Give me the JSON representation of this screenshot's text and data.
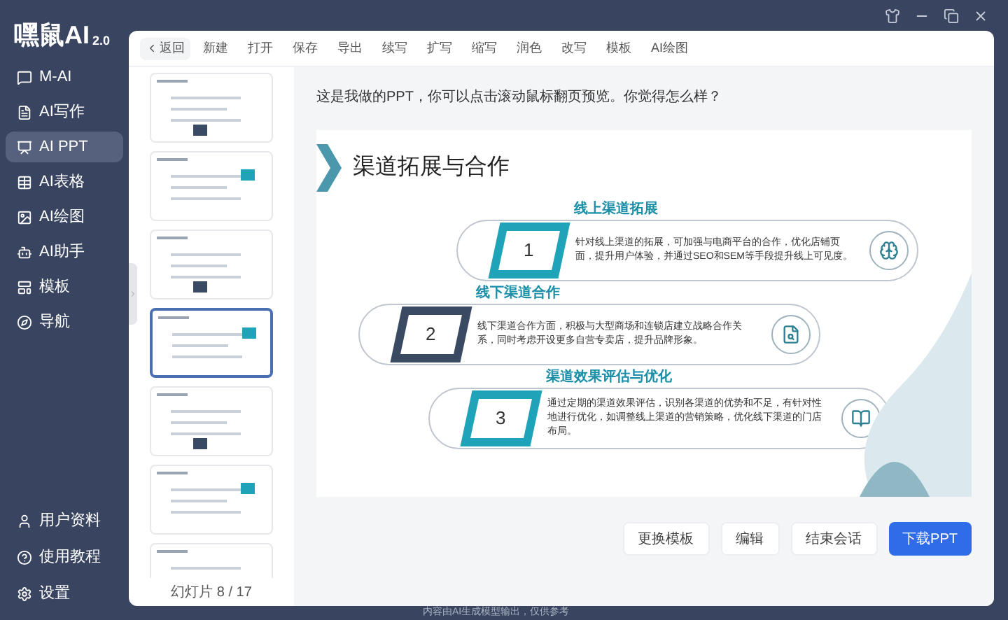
{
  "app": {
    "logo": "嘿鼠AI",
    "version": "2.0"
  },
  "sidebar": {
    "items": [
      {
        "label": "M-AI",
        "selected": false
      },
      {
        "label": "AI写作",
        "selected": false
      },
      {
        "label": "AI PPT",
        "selected": true
      },
      {
        "label": "AI表格",
        "selected": false
      },
      {
        "label": "AI绘图",
        "selected": false
      },
      {
        "label": "AI助手",
        "selected": false
      },
      {
        "label": "模板",
        "selected": false
      },
      {
        "label": "导航",
        "selected": false
      }
    ],
    "bottom_items": [
      {
        "label": "用户资料"
      },
      {
        "label": "使用教程"
      },
      {
        "label": "设置"
      }
    ]
  },
  "toolbar": {
    "back": "返回",
    "items": [
      "新建",
      "打开",
      "保存",
      "导出",
      "续写",
      "扩写",
      "缩写",
      "润色",
      "改写",
      "模板",
      "AI绘图"
    ]
  },
  "thumbnails": [
    {
      "selected": false
    },
    {
      "selected": false
    },
    {
      "selected": false
    },
    {
      "selected": true
    },
    {
      "selected": false
    },
    {
      "selected": false
    },
    {
      "selected": false
    }
  ],
  "slide_counter": "幻灯片 8 / 17",
  "chat": {
    "message": "这是我做的PPT，你可以点击滚动鼠标翻页预览。你觉得怎么样？"
  },
  "slide": {
    "title": "渠道拓展与合作",
    "items": [
      {
        "number": "1",
        "heading": "线上渠道拓展",
        "body": "针对线上渠道的拓展，可加强与电商平台的合作，优化店铺页面，提升用户体验，并通过SEO和SEM等手段提升线上可见度。",
        "color": "#1fa3b8"
      },
      {
        "number": "2",
        "heading": "线下渠道合作",
        "body": "线下渠道合作方面，积极与大型商场和连锁店建立战略合作关系，同时考虑开设更多自营专卖店，提升品牌形象。",
        "color": "#3b4a63"
      },
      {
        "number": "3",
        "heading": "渠道效果评估与优化",
        "body": "通过定期的渠道效果评估，识别各渠道的优势和不足，有针对性地进行优化，如调整线上渠道的营销策略，优化线下渠道的门店布局。",
        "color": "#1fa3b8"
      }
    ]
  },
  "actions": [
    {
      "label": "更换模板",
      "kind": "secondary"
    },
    {
      "label": "编辑",
      "kind": "secondary"
    },
    {
      "label": "结束会话",
      "kind": "secondary"
    },
    {
      "label": "下载PPT",
      "kind": "primary"
    }
  ],
  "footer": "内容由AI生成模型输出，仅供参考"
}
